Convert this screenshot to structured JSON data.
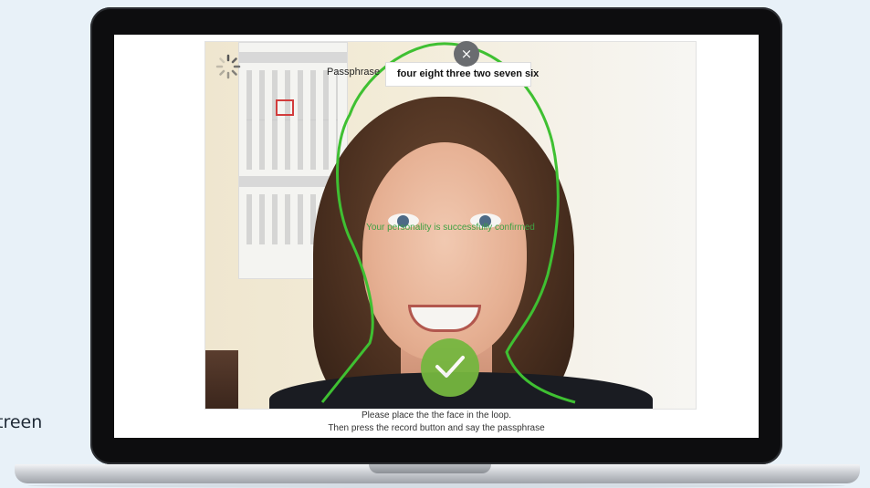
{
  "side_label": "treen",
  "camera": {
    "passphrase_label": "Passphrase",
    "passphrase_value": "four eight three two seven six",
    "close_symbol": "×",
    "confirmation": "Your personality is successfully confirmed",
    "status_icon": "loading-spinner-icon",
    "record_icon": "checkmark-icon",
    "colors": {
      "outline": "#3fc032",
      "record_button": "#75b63f",
      "confirmation": "#3fa142"
    }
  },
  "instructions": {
    "line1": "Please place the the face in the loop.",
    "line2": "Then press the record button and say the passphrase"
  }
}
